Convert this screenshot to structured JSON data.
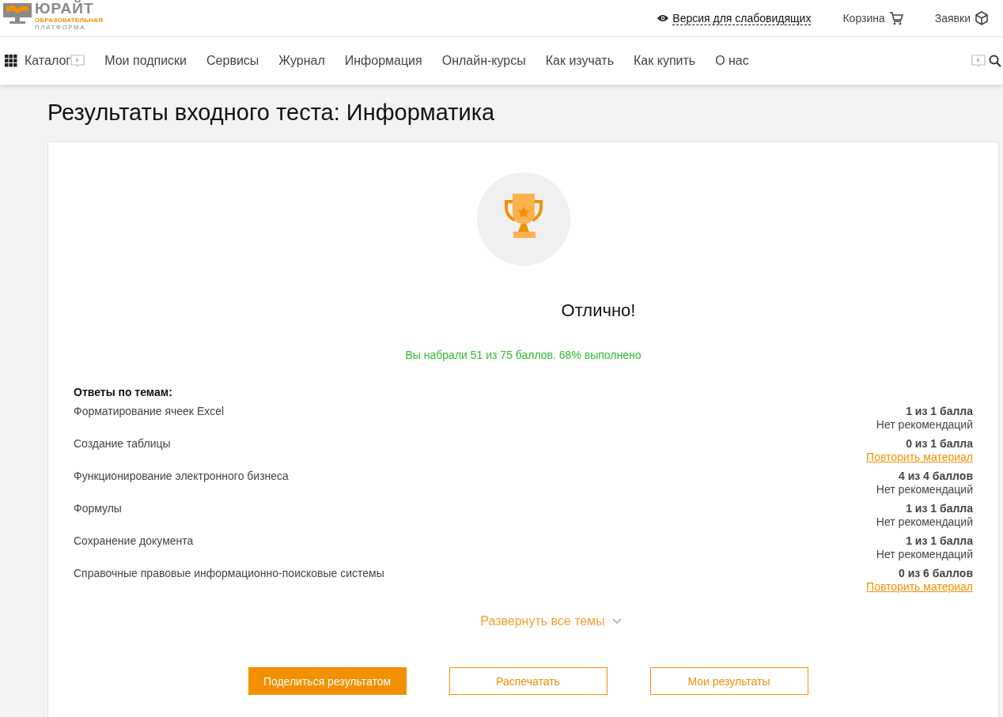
{
  "logo": {
    "name": "ЮРАЙТ",
    "line_1": "ОБРАЗОВАТЕЛЬНАЯ",
    "line_2": "ПЛАТФОРМА"
  },
  "top_links": [
    {
      "label": "Версия для слабовидящих",
      "kind": "eye"
    },
    {
      "label": "Корзина",
      "kind": "cart"
    },
    {
      "label": "Заявки",
      "kind": "box"
    }
  ],
  "nav": [
    "Каталог",
    "Мои подписки",
    "Сервисы",
    "Журнал",
    "Информация",
    "Онлайн-курсы",
    "Как изучать",
    "Как купить",
    "О нас"
  ],
  "title": "Результаты входного теста: Информатика",
  "result": {
    "heading": "Отлично!",
    "summary": "Вы набрали 51 из 75 баллов. 68% выполнено"
  },
  "topics_heading": "Ответы по темам:",
  "topics": [
    {
      "name": "Форматирование ячеек Excel",
      "score": "1 из 1 балла",
      "recommendation": "Нет рекомендаций",
      "kind": "text"
    },
    {
      "name": "Создание таблицы",
      "score": "0 из 1 балла",
      "recommendation": "Повторить материал",
      "kind": "link"
    },
    {
      "name": "Функционирование электронного бизнеса",
      "score": "4 из 4 баллов",
      "recommendation": "Нет рекомендаций",
      "kind": "text"
    },
    {
      "name": "Формулы",
      "score": "1 из 1 балла",
      "recommendation": "Нет рекомендаций",
      "kind": "text"
    },
    {
      "name": "Сохранение документа",
      "score": "1 из 1 балла",
      "recommendation": "Нет рекомендаций",
      "kind": "text"
    },
    {
      "name": "Справочные правовые информационно-поисковые системы",
      "score": "0 из 6 баллов",
      "recommendation": "Повторить материал",
      "kind": "link"
    }
  ],
  "expand": "Развернуть все темы",
  "buttons": [
    {
      "label": "Поделиться результатом",
      "kind": "primary"
    },
    {
      "label": "Распечатать",
      "kind": "outline"
    },
    {
      "label": "Мои результаты",
      "kind": "outline"
    }
  ]
}
